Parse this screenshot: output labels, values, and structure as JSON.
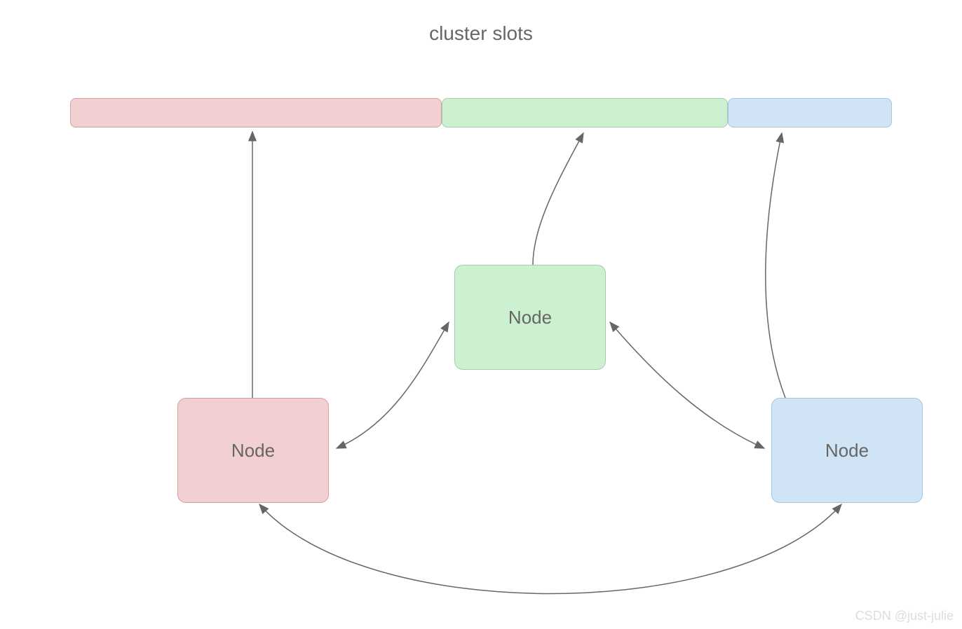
{
  "title": "cluster slots",
  "slots": {
    "segments": [
      {
        "color": "pink"
      },
      {
        "color": "green"
      },
      {
        "color": "blue"
      }
    ]
  },
  "nodes": {
    "pink": {
      "label": "Node"
    },
    "green": {
      "label": "Node"
    },
    "blue": {
      "label": "Node"
    }
  },
  "watermark": "CSDN @just-julie"
}
